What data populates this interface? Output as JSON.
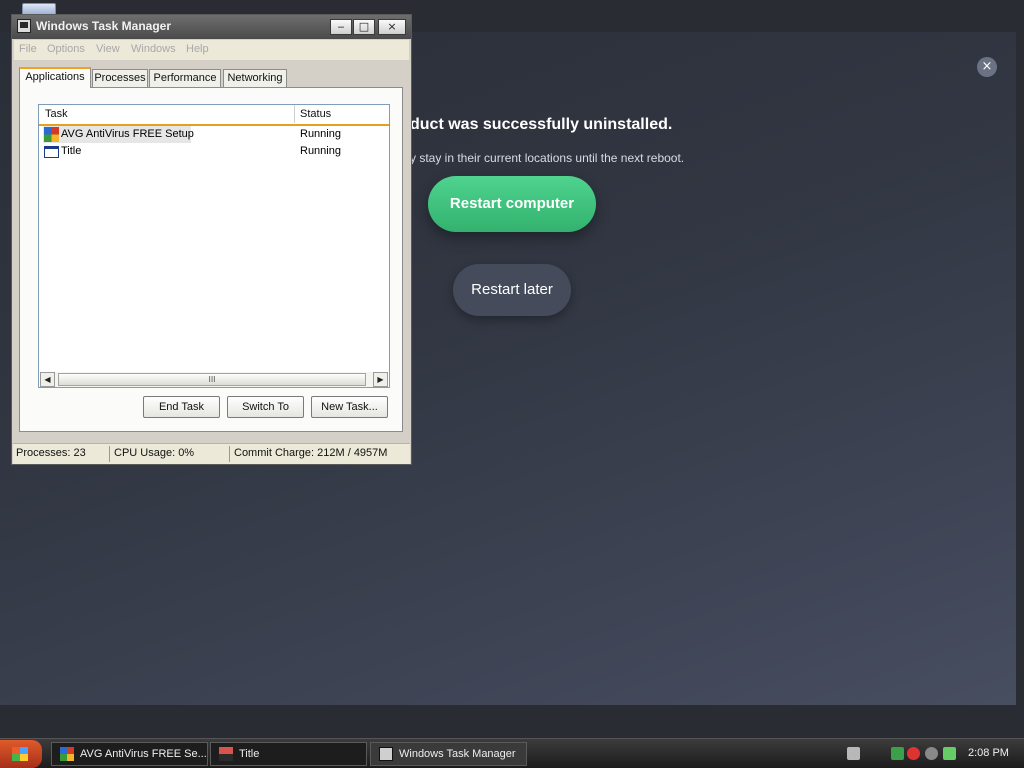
{
  "avg": {
    "title": "duct was successfully uninstalled.",
    "subtitle": "y stay in their current locations until the next reboot.",
    "primary_button": "Restart computer",
    "secondary_button": "Restart later",
    "close_glyph": "×"
  },
  "task_manager": {
    "title": "Windows Task Manager",
    "window_buttons": {
      "minimize": "‒",
      "maximize": "□",
      "close": "×"
    },
    "menu": [
      "File",
      "Options",
      "View",
      "Windows",
      "Help"
    ],
    "tabs": [
      "Applications",
      "Processes",
      "Performance",
      "Networking"
    ],
    "active_tab": "Applications",
    "columns": {
      "task": "Task",
      "status": "Status"
    },
    "rows": [
      {
        "task": "AVG AntiVirus FREE Setup",
        "status": "Running",
        "icon": "avg-icon"
      },
      {
        "task": "Title",
        "status": "Running",
        "icon": "window-icon"
      }
    ],
    "scroll_thumb": "III",
    "buttons": {
      "end_task": "End Task",
      "switch_to": "Switch To",
      "new_task": "New Task..."
    },
    "status": {
      "processes": "Processes: 23",
      "cpu": "CPU Usage: 0%",
      "commit": "Commit Charge: 212M / 4957M"
    }
  },
  "taskbar": {
    "items": [
      {
        "label": "AVG AntiVirus FREE Se...",
        "icon": "avg-icon"
      },
      {
        "label": "Title",
        "icon": "window-icon"
      },
      {
        "label": "Windows Task Manager",
        "icon": "task-manager-icon"
      }
    ],
    "clock": "2:08 PM"
  },
  "colors": {
    "accent_green": "#3cc27c",
    "tab_accent": "#f2a023"
  }
}
